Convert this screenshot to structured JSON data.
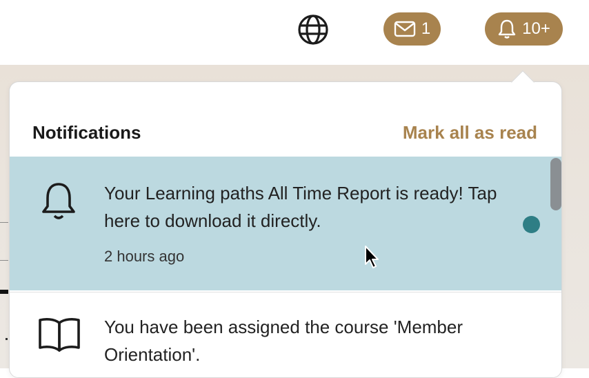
{
  "topbar": {
    "globe_icon": "globe-icon",
    "messages": {
      "icon": "mail-icon",
      "count": "1"
    },
    "notifications": {
      "icon": "bell-icon",
      "count": "10+"
    }
  },
  "panel": {
    "title": "Notifications",
    "mark_all_label": "Mark all as read",
    "items": [
      {
        "icon": "bell-icon",
        "text": "Your Learning paths All Time Report is ready! Tap here to download it directly.",
        "time": "2 hours ago",
        "unread": true
      },
      {
        "icon": "book-icon",
        "text": "You have been assigned the course 'Member Orientation'.",
        "unread": false
      }
    ]
  },
  "colors": {
    "accent": "#A8834E",
    "highlight_row": "#BCD9E0",
    "unread_dot": "#2E7E85"
  }
}
